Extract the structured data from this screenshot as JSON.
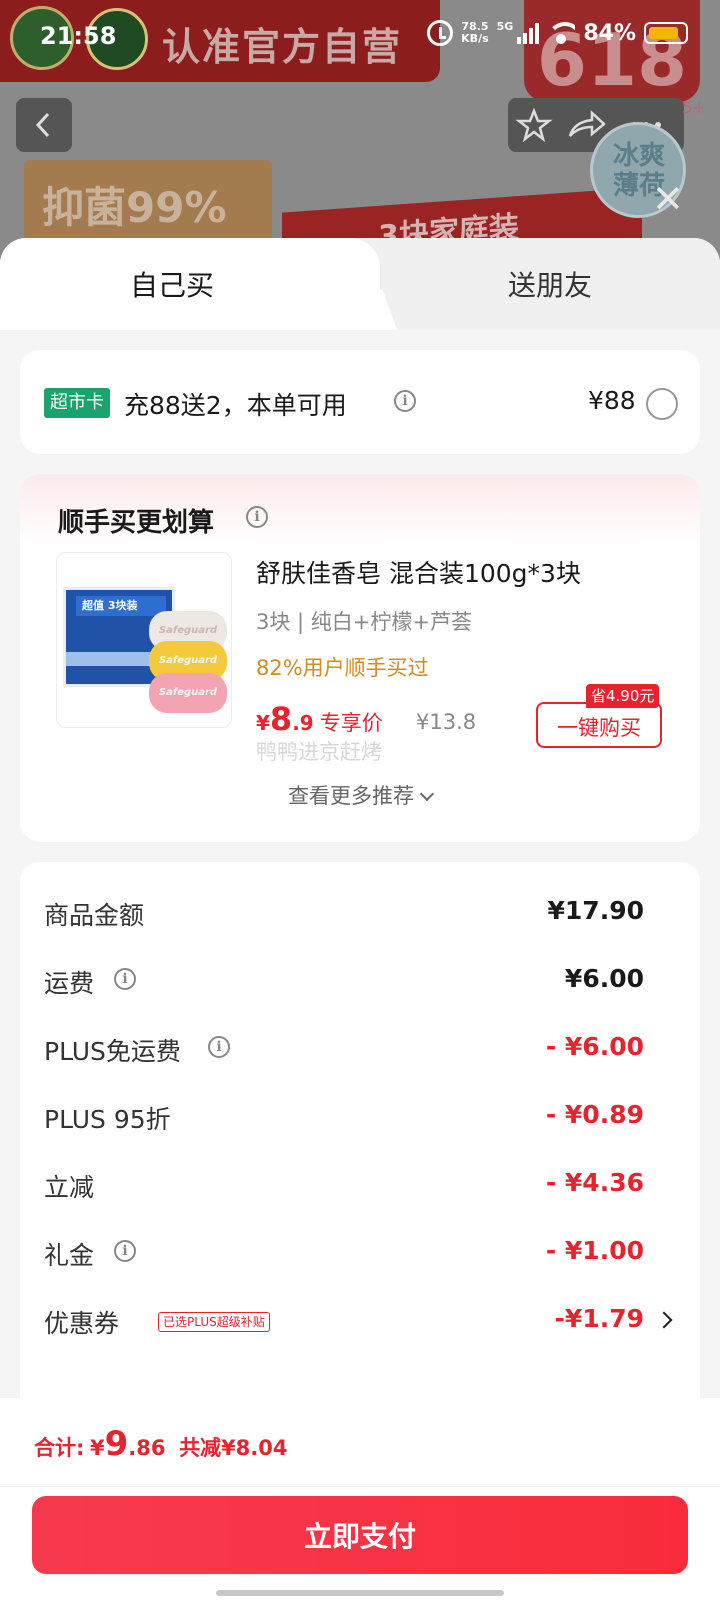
{
  "status_bar": {
    "time": "21:58",
    "net_speed_value": "78.5",
    "net_speed_unit": "KB/s",
    "network": "5G",
    "battery": "84%",
    "battery_level": 0.84
  },
  "backdrop": {
    "banner_text": "认准官方自营",
    "promo_number": "618",
    "badge_count": "5+",
    "left_promo": "抑菌99%",
    "center_promo": "3块家庭装",
    "circle_promo": "冰爽薄荷"
  },
  "tabs": {
    "self": "自己买",
    "friend": "送朋友"
  },
  "supermarket": {
    "badge": "超市卡",
    "text": "充88送2，本单可用",
    "price": "¥88"
  },
  "addon": {
    "title": "顺手买更划算",
    "product_name": "舒肤佳香皂 混合装100g*3块",
    "spec": "3块 | 纯白+柠檬+芦荟",
    "social": "82%用户顺手买过",
    "price_yen": "¥",
    "price_int": "8",
    "price_dec": ".9",
    "price_tag": "专享价",
    "original_price": "¥13.8",
    "save_badge": "省4.90元",
    "buy_button": "一键购买",
    "watermark": "鸭鸭进京赶烤",
    "more": "查看更多推荐",
    "image_text": {
      "box_top": "超值 3块装",
      "soap_brand": "Safeguard"
    }
  },
  "summary": {
    "rows": [
      {
        "label": "商品金额",
        "value": "¥17.90"
      },
      {
        "label": "运费",
        "value": "¥6.00"
      },
      {
        "label": "PLUS免运费",
        "value": "- ¥6.00"
      },
      {
        "label": "PLUS 95折",
        "value": "- ¥0.89"
      },
      {
        "label": "立减",
        "value": "- ¥4.36"
      },
      {
        "label": "礼金",
        "value": "- ¥1.00"
      },
      {
        "label": "优惠券",
        "value": "-¥1.79",
        "tag": "已选PLUS超级补贴"
      }
    ]
  },
  "footer": {
    "total_label": "合计:",
    "total_yen": "¥",
    "total_int": "9",
    "total_dec": ".86",
    "total_saved": "共减¥8.04",
    "pay_button": "立即支付"
  },
  "colors": {
    "accent_red": "#e8232e",
    "supermarket_green": "#1aa36c",
    "social_orange": "#d98a1c"
  }
}
